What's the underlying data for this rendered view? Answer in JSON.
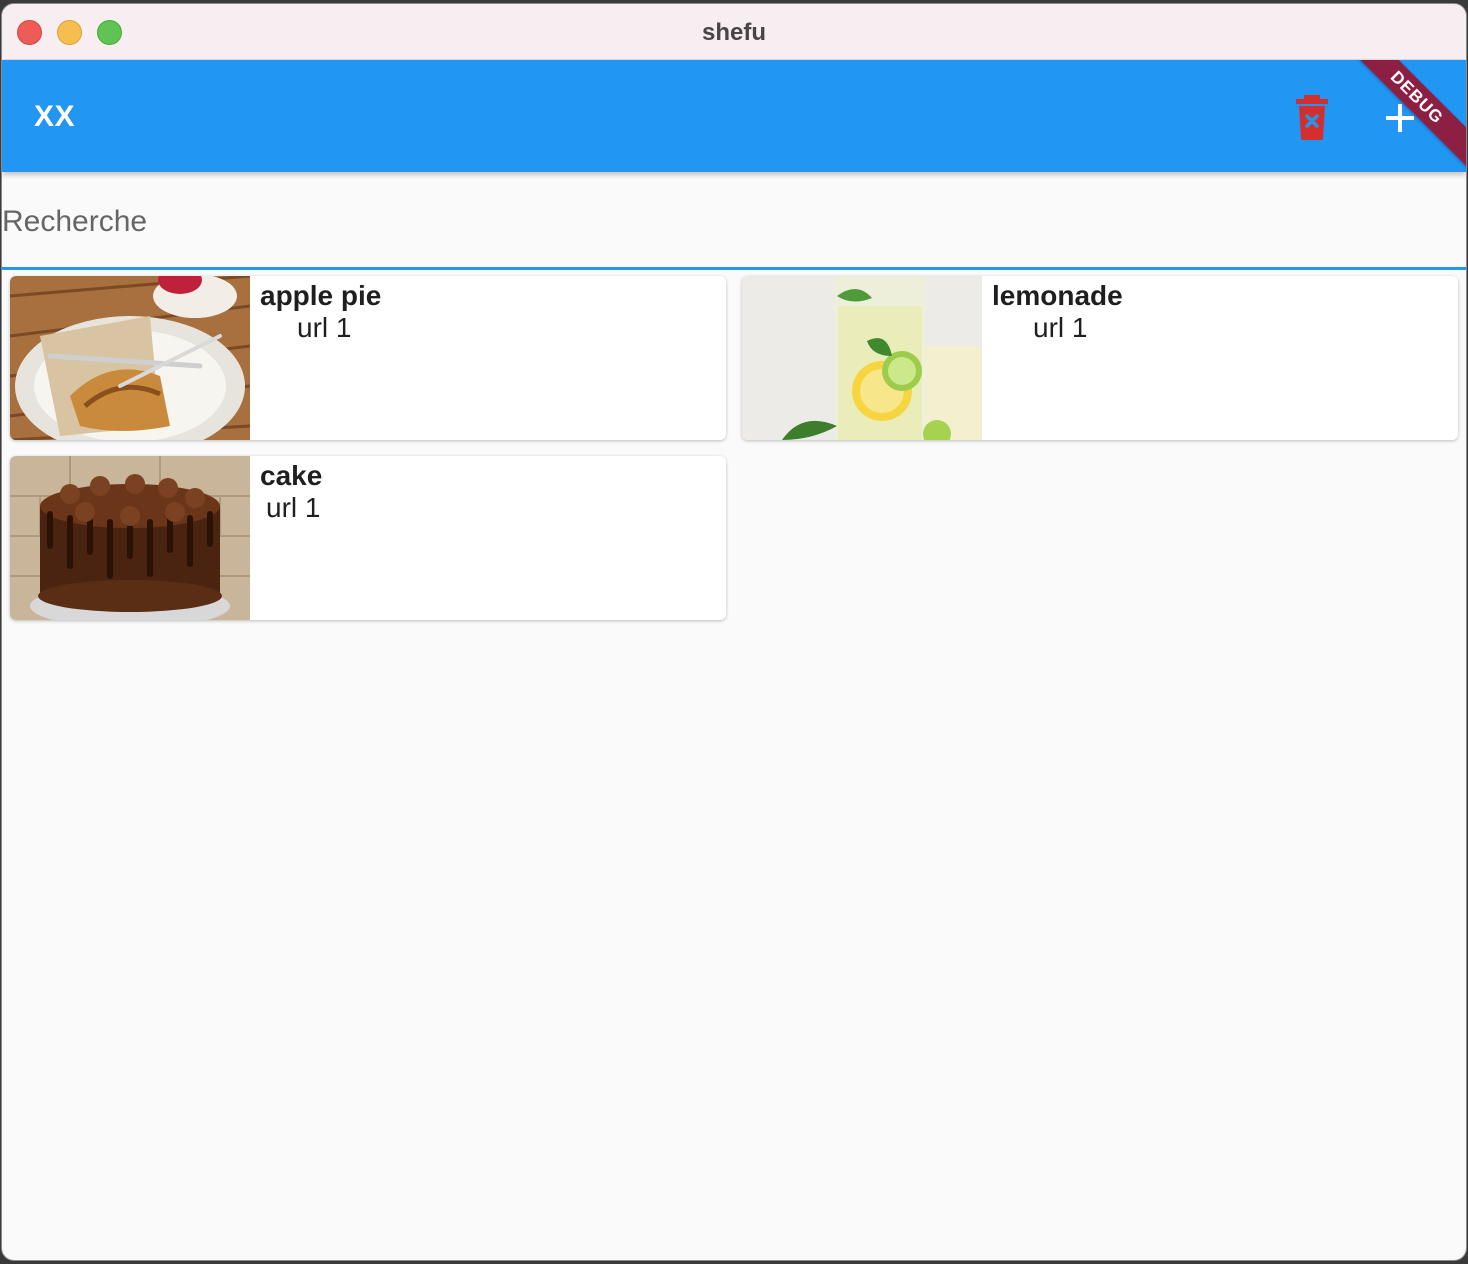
{
  "window": {
    "title": "shefu"
  },
  "appbar": {
    "title": "XX",
    "delete_icon": "delete-forever-icon",
    "add_icon": "plus-icon",
    "debug_banner": "DEBUG",
    "colors": {
      "appbar": "#2196f3",
      "delete_icon": "#d32f2f",
      "debug_ribbon": "#8d1f42"
    }
  },
  "search": {
    "placeholder": "Recherche",
    "value": ""
  },
  "recipes": [
    {
      "name": "apple pie",
      "subtitle": "url 1",
      "image": "apple-pie-photo"
    },
    {
      "name": "lemonade",
      "subtitle": "url 1",
      "image": "lemonade-photo"
    },
    {
      "name": "cake",
      "subtitle": "url 1",
      "image": "chocolate-cake-photo"
    }
  ]
}
